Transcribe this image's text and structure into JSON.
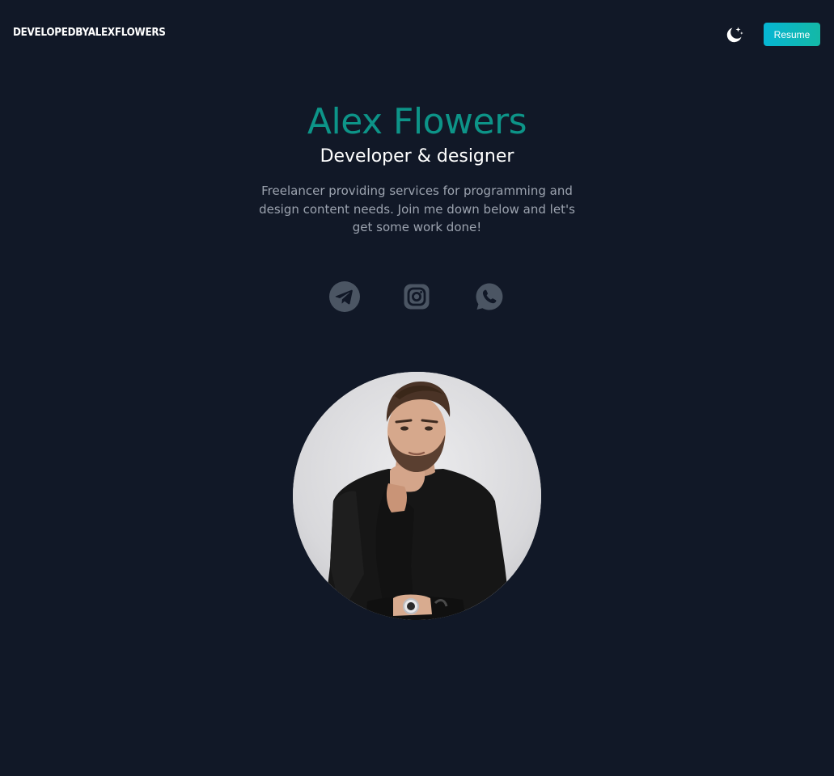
{
  "nav": {
    "logo": "DevelopedByAlexFlowers",
    "resume_label": "Resume",
    "theme_icon": "moon-stars-icon"
  },
  "hero": {
    "name": "Alex Flowers",
    "role": "Developer & designer",
    "description": "Freelancer providing services for programming and design content needs. Join me down below and let's get some work done!"
  },
  "socials": [
    {
      "icon": "telegram-icon"
    },
    {
      "icon": "instagram-icon"
    },
    {
      "icon": "whatsapp-icon"
    }
  ],
  "avatar": {
    "icon": "profile-photo"
  },
  "colors": {
    "background": "#111827",
    "accent": "#0d9488",
    "button": "#06b6d4",
    "muted_text": "#9ca3af",
    "social_icon": "#4b5563"
  }
}
